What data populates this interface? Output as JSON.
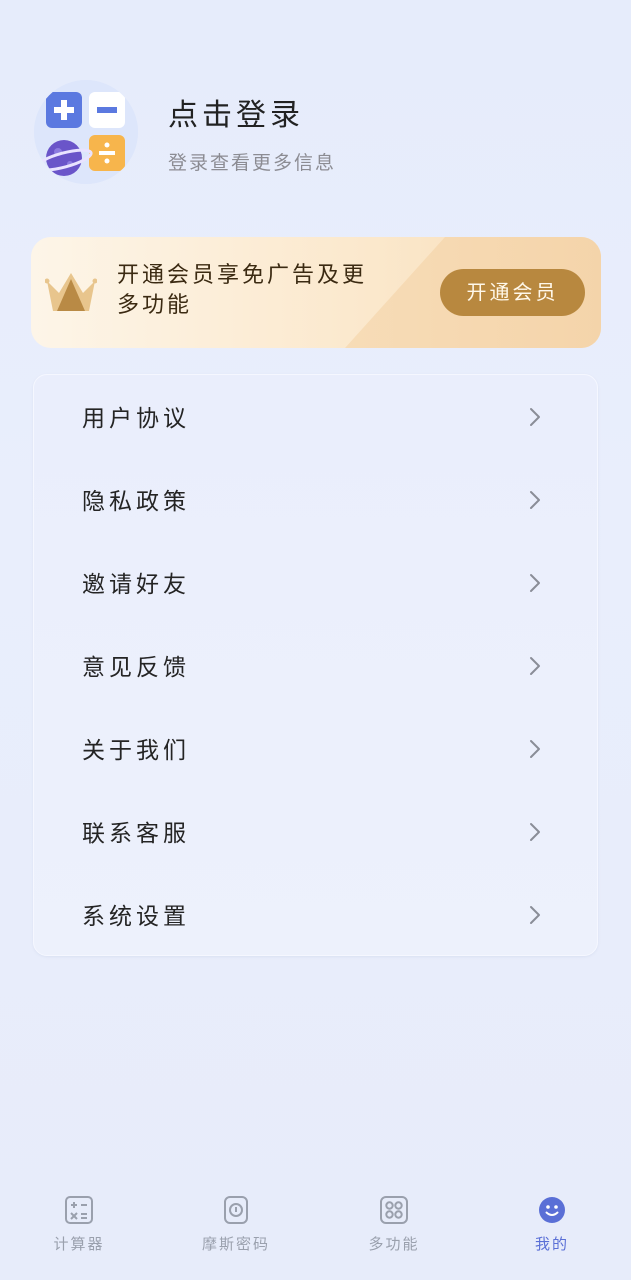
{
  "profile": {
    "title": "点击登录",
    "subtitle": "登录查看更多信息",
    "avatar_icon": "calculator-planet-avatar"
  },
  "vip_banner": {
    "text": "开通会员享免广告及更多功能",
    "button_label": "开通会员",
    "icon": "crown-icon"
  },
  "menu": {
    "items": [
      {
        "label": "用户协议"
      },
      {
        "label": "隐私政策"
      },
      {
        "label": "邀请好友"
      },
      {
        "label": "意见反馈"
      },
      {
        "label": "关于我们"
      },
      {
        "label": "联系客服"
      },
      {
        "label": "系统设置"
      }
    ]
  },
  "tabbar": {
    "tabs": [
      {
        "label": "计算器",
        "icon": "calculator-icon",
        "active": false
      },
      {
        "label": "摩斯密码",
        "icon": "lock-icon",
        "active": false
      },
      {
        "label": "多功能",
        "icon": "grid-icon",
        "active": false
      },
      {
        "label": "我的",
        "icon": "smiley-icon",
        "active": true
      }
    ]
  },
  "colors": {
    "accent": "#5a6fd6",
    "vip_button": "#b8883f",
    "background": "#e6ecfb"
  }
}
